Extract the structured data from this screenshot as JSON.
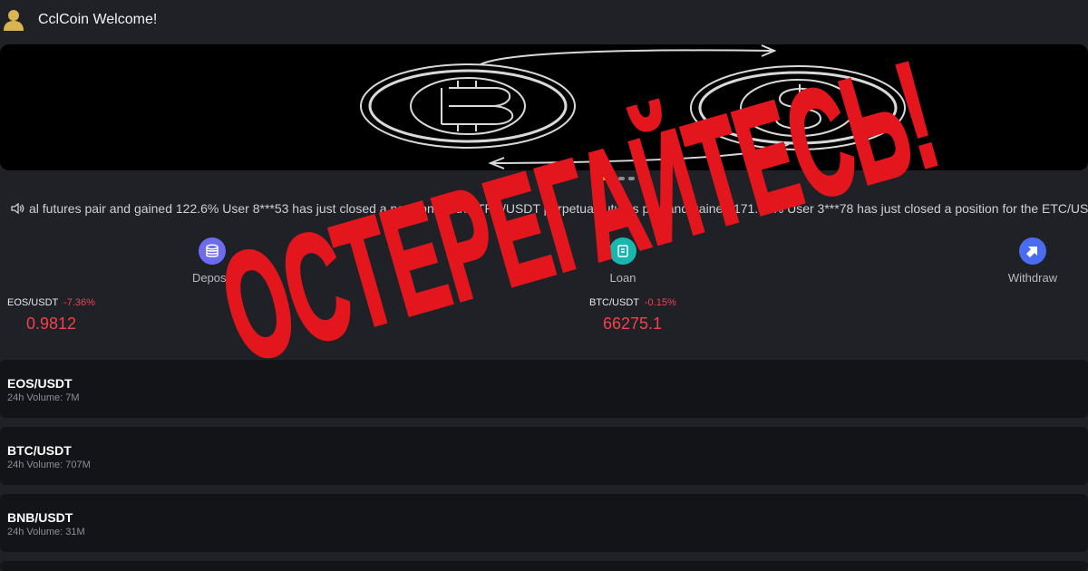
{
  "header": {
    "title": "CclCoin Welcome!",
    "avatar_icon": "user-icon"
  },
  "banner": {
    "icon_left": "bitcoin-icon",
    "icon_right": "dollar-icon",
    "slides": 4,
    "active_slide": 1
  },
  "ticker": {
    "icon": "speaker-icon",
    "text": "al futures pair and gained 122.6% User 8***53 has just closed a position for the TRX/USDT perpetual futures pair and gained 171.31% User 3***78 has just closed a position for the ETC/USDT"
  },
  "actions": [
    {
      "label": "Deposit",
      "icon": "coins-icon"
    },
    {
      "label": "Loan",
      "icon": "loan-icon"
    },
    {
      "label": "Withdraw",
      "icon": "withdraw-icon"
    }
  ],
  "prices": [
    {
      "pair": "EOS/USDT",
      "change": "-7.36%",
      "price": "0.9812"
    },
    {
      "pair": "BTC/USDT",
      "change": "-0.15%",
      "price": "66275.1"
    }
  ],
  "markets": [
    {
      "symbol": "EOS/USDT",
      "volume": "24h Volume: 7M"
    },
    {
      "symbol": "BTC/USDT",
      "volume": "24h Volume: 707M"
    },
    {
      "symbol": "BNB/USDT",
      "volume": "24h Volume: 31M"
    }
  ],
  "overlay": {
    "text": "ОСТЕРЕГАЙТЕСЬ!",
    "color": "#e3161d"
  },
  "colors": {
    "accent": "#f0b90b",
    "negative": "#f0424d",
    "background": "#1f2126",
    "row": "#131418"
  }
}
